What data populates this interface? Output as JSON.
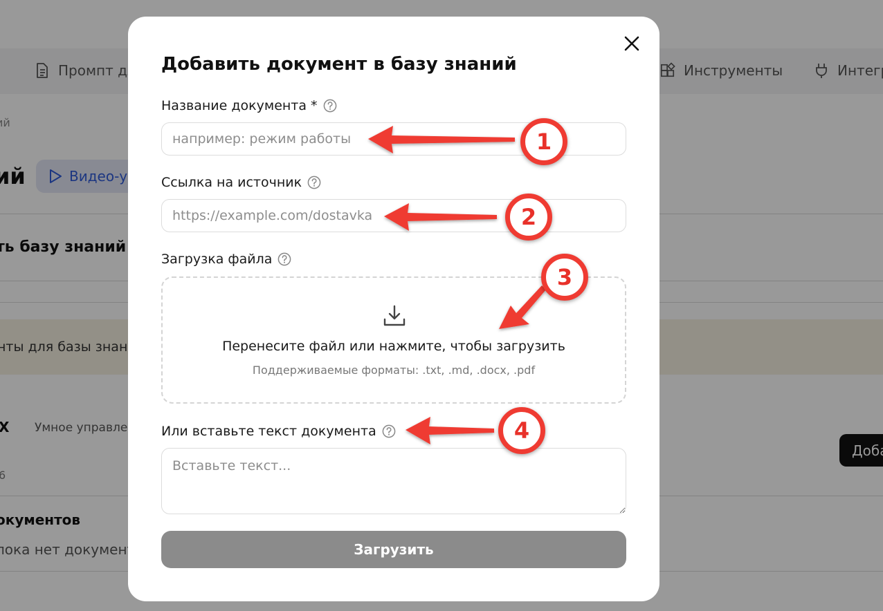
{
  "background": {
    "tabs": [
      {
        "label": "Промпт дл",
        "icon": "document-icon"
      },
      {
        "label": "Инструменты",
        "icon": "tools-grid-icon"
      },
      {
        "label": "Интегр",
        "icon": "plug-icon"
      }
    ],
    "breadcrumb": "ий",
    "page_title": "ий",
    "video_button": "Видео-у",
    "section_title": "ть базу знаний д",
    "notice": "нты для базы знани",
    "item_letter": "X",
    "item_desc": "Умное управлен",
    "item_meta": "6",
    "docs_heading": "окументов",
    "docs_empty": "лока нет документо",
    "add_button": "Доба"
  },
  "modal": {
    "title": "Добавить документ в базу знаний",
    "name_label": "Название документа *",
    "name_placeholder": "например: режим работы",
    "name_value": "",
    "source_label": "Ссылка на источник",
    "source_placeholder": "https://example.com/dostavka",
    "source_value": "",
    "file_label": "Загрузка файла",
    "drop_main": "Перенесите файл или нажмите, чтобы загрузить",
    "drop_sub": "Поддерживаемые форматы: .txt, .md, .docx, .pdf",
    "text_label": "Или вставьте текст документа",
    "text_placeholder": "Вставьте текст...",
    "text_value": "",
    "submit_label": "Загрузить"
  },
  "annotations": [
    {
      "number": "1"
    },
    {
      "number": "2"
    },
    {
      "number": "3"
    },
    {
      "number": "4"
    }
  ],
  "colors": {
    "annotation_red": "#ef3b32",
    "submit_disabled": "#8b8b8b",
    "overlay": "rgba(0,0,0,0.40)",
    "video_button_text": "#2f5ad8"
  }
}
